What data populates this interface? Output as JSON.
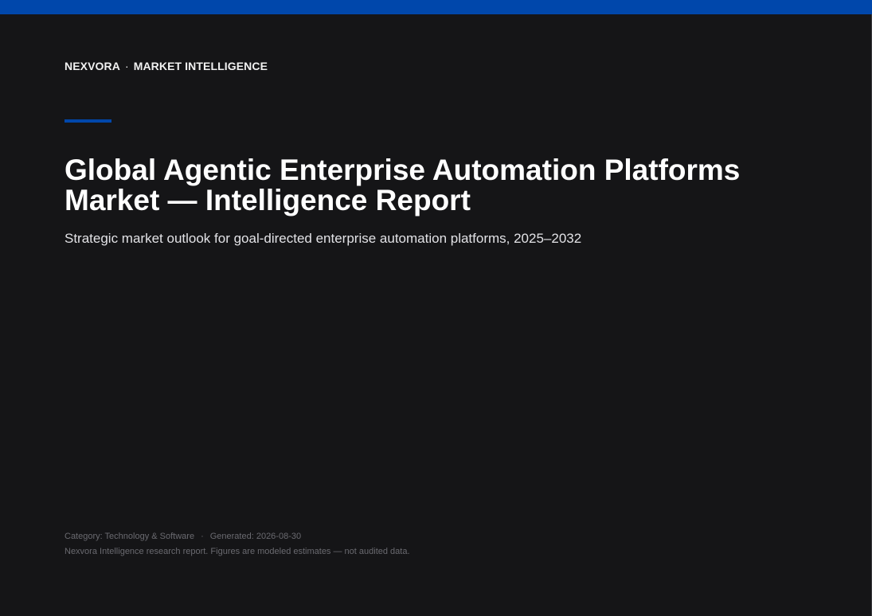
{
  "brand": {
    "name": "NEXVORA",
    "separator": "·",
    "section": "MARKET INTELLIGENCE"
  },
  "report": {
    "title": "Global Agentic Enterprise Automation Platforms Market — Intelligence Report",
    "subtitle": "Strategic market outlook for goal-directed enterprise automation platforms, 2025–2032"
  },
  "footer": {
    "category": "Category: Technology & Software",
    "separator": "·",
    "generated": "Generated: 2026-08-30",
    "disclaimer": "Nexvora Intelligence research report. Figures are modeled estimates — not audited data."
  },
  "colors": {
    "accent": "#0047ab",
    "background": "#151517",
    "title_text": "#ffffff",
    "muted_text": "#6a6a70"
  }
}
